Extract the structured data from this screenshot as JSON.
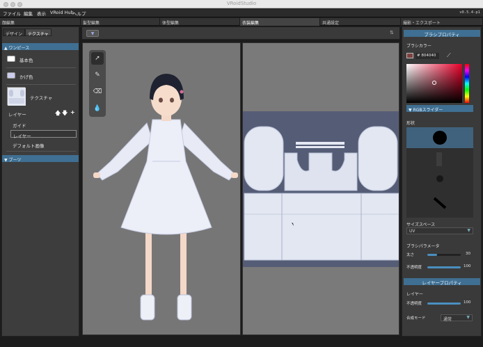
{
  "window": {
    "title": "VRoidStudio"
  },
  "menubar": {
    "items": [
      "ファイル",
      "編集",
      "表示",
      "VRoid Hub",
      "ヘルプ"
    ],
    "version": "v0.5.4-p1"
  },
  "mode_tabs": [
    "顔編集",
    "髪型編集",
    "体型編集",
    "衣装編集",
    "共通設定",
    "撮影・エクスポート"
  ],
  "left_panel": {
    "tabs": [
      "デザイン",
      "テクスチャ"
    ],
    "section_onepiece": "▲ ワンピース",
    "base_color_label": "基本色",
    "base_color": "#ffffff",
    "shadow_color_label": "かげ色",
    "shadow_color": "#ccccee",
    "texture_label": "テクスチャ",
    "layer_title": "レイヤー",
    "layer_controls": [
      "🡅",
      "🡇",
      "+"
    ],
    "layers": [
      "ガイド",
      "レイヤー",
      "デフォルト画像"
    ],
    "section_boots": "▼ ブーツ"
  },
  "view": {
    "tools": [
      "cursor-icon",
      "pen-icon",
      "eraser-icon",
      "fill-icon"
    ]
  },
  "right_panel": {
    "brush_properties_title": "ブラシプロパティ",
    "brush_color_label": "ブラシカラー",
    "brush_color_hex": "# 804040",
    "brush_color": "#804040",
    "rgb_slider_label": "▼ RGBスライダー",
    "shape_label": "形状",
    "size_space_label": "サイズスペース",
    "size_space_value": "UV",
    "brush_params_label": "ブラシパラメータ",
    "thickness_label": "太さ",
    "thickness_value": "30",
    "thickness_fraction": 0.3,
    "opacity_label": "不透明度",
    "opacity_value": "100",
    "opacity_fraction": 1.0,
    "layer_properties_title": "レイヤープロパティ",
    "layer_label": "レイヤー",
    "layer_opacity_label": "不透明度",
    "layer_opacity_value": "100",
    "layer_opacity_fraction": 1.0,
    "blend_mode_label": "合成モード",
    "blend_mode_value": "通常"
  },
  "colors": {
    "accent": "#3f6f92",
    "panel_bg": "#3d3d3d"
  }
}
